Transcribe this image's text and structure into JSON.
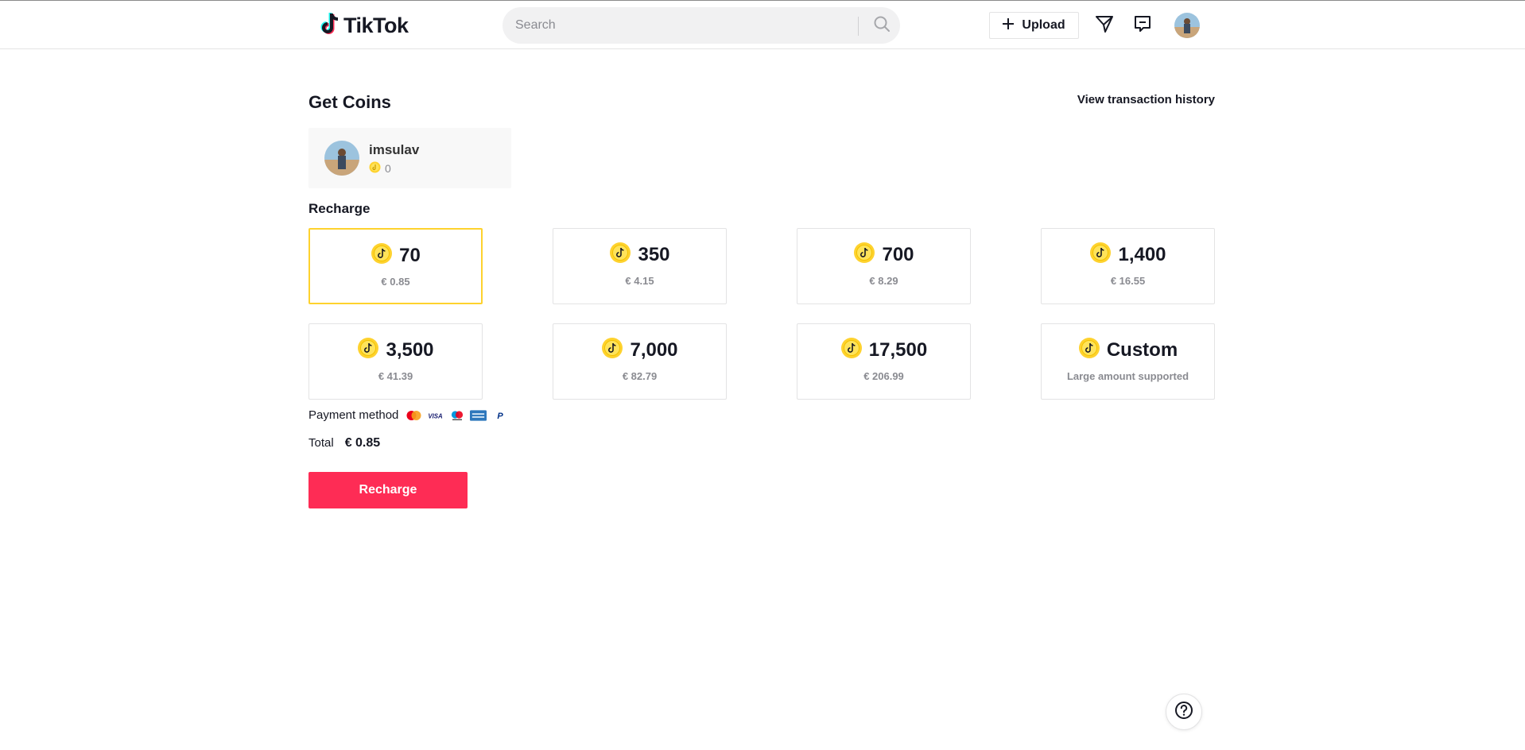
{
  "header": {
    "logo_text": "TikTok",
    "search": {
      "placeholder": "Search",
      "value": ""
    },
    "upload_label": "Upload",
    "icons": [
      "tiktok-logo-icon",
      "search-icon",
      "plus-icon",
      "send-icon",
      "inbox-icon",
      "avatar"
    ]
  },
  "main": {
    "title": "Get Coins",
    "history_link": "View transaction history",
    "user": {
      "name": "imsulav",
      "coins": "0"
    },
    "recharge_label": "Recharge",
    "packages": [
      {
        "amount": "70",
        "price": "€ 0.85",
        "selected": true
      },
      {
        "amount": "350",
        "price": "€ 4.15",
        "selected": false
      },
      {
        "amount": "700",
        "price": "€ 8.29",
        "selected": false
      },
      {
        "amount": "1,400",
        "price": "€ 16.55",
        "selected": false
      },
      {
        "amount": "3,500",
        "price": "€ 41.39",
        "selected": false
      },
      {
        "amount": "7,000",
        "price": "€ 82.79",
        "selected": false
      },
      {
        "amount": "17,500",
        "price": "€ 206.99",
        "selected": false
      },
      {
        "amount": "Custom",
        "price": "Large amount supported",
        "selected": false
      }
    ],
    "payment_label": "Payment method",
    "payment_methods": [
      "mastercard-icon",
      "visa-icon",
      "maestro-icon",
      "amex-icon",
      "paypal-icon"
    ],
    "visa_text": "VISA",
    "paypal_text": "P",
    "total_label": "Total",
    "total_value": "€ 0.85",
    "recharge_button": "Recharge"
  },
  "colors": {
    "accent": "#fe2c55",
    "selected_border": "#fed22e",
    "coin": "#fed22e",
    "text": "#161823",
    "muted": "#8a8b91"
  }
}
